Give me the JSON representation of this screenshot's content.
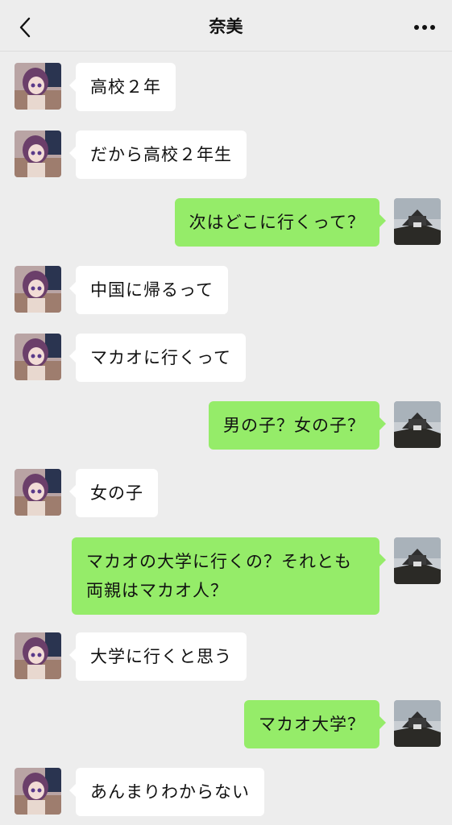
{
  "header": {
    "title": "奈美",
    "back_icon": "chevron-left-icon",
    "more_icon": "more-dots-icon"
  },
  "colors": {
    "background": "#ededed",
    "incoming_bubble": "#ffffff",
    "outgoing_bubble": "#95ec69"
  },
  "messages": [
    {
      "side": "in",
      "text": "高校２年"
    },
    {
      "side": "in",
      "text": "だから高校２年生"
    },
    {
      "side": "out",
      "text": "次はどこに行くって？"
    },
    {
      "side": "in",
      "text": "中国に帰るって"
    },
    {
      "side": "in",
      "text": "マカオに行くって"
    },
    {
      "side": "out",
      "text": "男の子？女の子？"
    },
    {
      "side": "in",
      "text": "女の子"
    },
    {
      "side": "out",
      "text": "マカオの大学に行くの？それとも両親はマカオ人？"
    },
    {
      "side": "in",
      "text": "大学に行くと思う"
    },
    {
      "side": "out",
      "text": "マカオ大学？"
    },
    {
      "side": "in",
      "text": "あんまりわからない"
    }
  ]
}
